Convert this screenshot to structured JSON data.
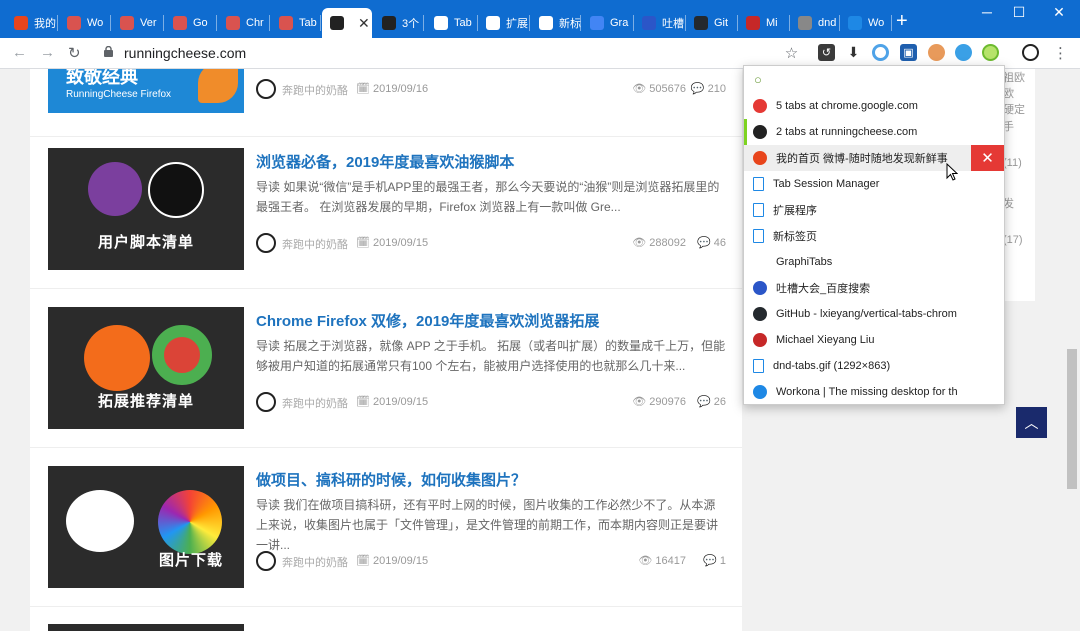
{
  "tabs": [
    {
      "label": "我的",
      "color": "#e8451c",
      "icon": "weibo-icon"
    },
    {
      "label": "Wo",
      "color": "#d9534f",
      "icon": "site-icon"
    },
    {
      "label": "Ver",
      "color": "#d9534f",
      "icon": "site-icon"
    },
    {
      "label": "Go",
      "color": "#d9534f",
      "icon": "site-icon"
    },
    {
      "label": "Chr",
      "color": "#d9534f",
      "icon": "site-icon"
    },
    {
      "label": "Tab",
      "color": "#d9534f",
      "icon": "site-icon"
    },
    {
      "label": "",
      "color": "#222",
      "icon": "panda-icon",
      "active": true
    },
    {
      "label": "3个",
      "color": "#222",
      "icon": "panda-icon"
    },
    {
      "label": "Tab",
      "color": "#fff",
      "icon": "doc-icon"
    },
    {
      "label": "扩展",
      "color": "#fff",
      "icon": "doc-icon"
    },
    {
      "label": "新标签页",
      "color": "#fff",
      "icon": "blank-icon"
    },
    {
      "label": "Gra",
      "color": "#4285f4",
      "icon": "google-icon"
    },
    {
      "label": "吐槽",
      "color": "#2b56c8",
      "icon": "baidu-icon"
    },
    {
      "label": "Git",
      "color": "#24292e",
      "icon": "github-icon"
    },
    {
      "label": "Mi",
      "color": "#c62828",
      "icon": "m-icon"
    },
    {
      "label": "dnd",
      "color": "#888",
      "icon": "globe-icon"
    },
    {
      "label": "Wo",
      "color": "#1e88e5",
      "icon": "workona-icon"
    }
  ],
  "window": {
    "minimize": "─",
    "maximize": "☐",
    "close": "✕",
    "new_tab": "+"
  },
  "address_bar": {
    "url": "runningcheese.com"
  },
  "articles": [
    {
      "title": "",
      "excerpt": "",
      "thumb_caption_line1": "致敬经典",
      "thumb_caption_line2": "RunningCheese Firefox",
      "author": "奔跑中的奶酪",
      "date": "2019/09/16",
      "views": "505676",
      "comments": "210"
    },
    {
      "title": "浏览器必备，2019年度最喜欢油猴脚本",
      "excerpt": "导读 如果说“微信”是手机APP里的最强王者，那么今天要说的“油猴”则是浏览器拓展里的最强王者。 在浏览器发展的早期，Firefox 浏览器上有一款叫做 Gre...",
      "thumb_caption": "用户脚本清单",
      "author": "奔跑中的奶酪",
      "date": "2019/09/15",
      "views": "288092",
      "comments": "46"
    },
    {
      "title": "Chrome Firefox 双修，2019年度最喜欢浏览器拓展",
      "excerpt": "导读 拓展之于浏览器，就像 APP 之于手机。 拓展（或者叫扩展）的数量成千上万，但能够被用户知道的拓展通常只有100 个左右，能被用户选择使用的也就那么几十来...",
      "thumb_caption": "拓展推荐清单",
      "author": "奔跑中的奶酪",
      "date": "2019/09/15",
      "views": "290976",
      "comments": "26"
    },
    {
      "title": "做项目、搞科研的时候，如何收集图片？",
      "excerpt": "导读 我们在做项目搞科研，还有平时上网的时候，图片收集的工作必然少不了。从本源上来说，收集图片也属于「文件管理」，是文件管理的前期工作，而本期内容则正是要讲一讲...",
      "thumb_caption": "图片下载",
      "author": "奔跑中的奶酪",
      "date": "2019/09/15",
      "views": "16417",
      "comments": "1"
    }
  ],
  "sidebar_fragments": [
    "祖欧",
    "欧",
    "硬定",
    "手",
    "(11)",
    "发",
    "(17)"
  ],
  "popup": {
    "items": [
      {
        "label": "5 tabs at chrome.google.com",
        "icon": "chrome-icon"
      },
      {
        "label": "2 tabs at runningcheese.com",
        "icon": "panda-icon",
        "selected": true
      },
      {
        "label": "我的首页 微博-随时随地发现新鲜事",
        "icon": "weibo-icon",
        "highlighted": true
      },
      {
        "label": "Tab Session Manager",
        "icon": "doc-icon"
      },
      {
        "label": "扩展程序",
        "icon": "doc-icon"
      },
      {
        "label": "新标签页",
        "icon": "doc-icon"
      },
      {
        "label": "GraphiTabs",
        "icon": "blank-icon"
      },
      {
        "label": "吐槽大会_百度搜索",
        "icon": "baidu-icon"
      },
      {
        "label": "GitHub - lxieyang/vertical-tabs-chrom",
        "icon": "github-icon"
      },
      {
        "label": "Michael Xieyang Liu",
        "icon": "m-icon"
      },
      {
        "label": "dnd-tabs.gif (1292×863)",
        "icon": "doc-icon"
      },
      {
        "label": "Workona | The missing desktop for th",
        "icon": "workona-icon"
      }
    ],
    "close_glyph": "✕"
  },
  "colors": {
    "tabstrip": "#0f6cd0",
    "link": "#1e73be",
    "accent_green": "#7ed321",
    "close_red": "#e53935"
  }
}
